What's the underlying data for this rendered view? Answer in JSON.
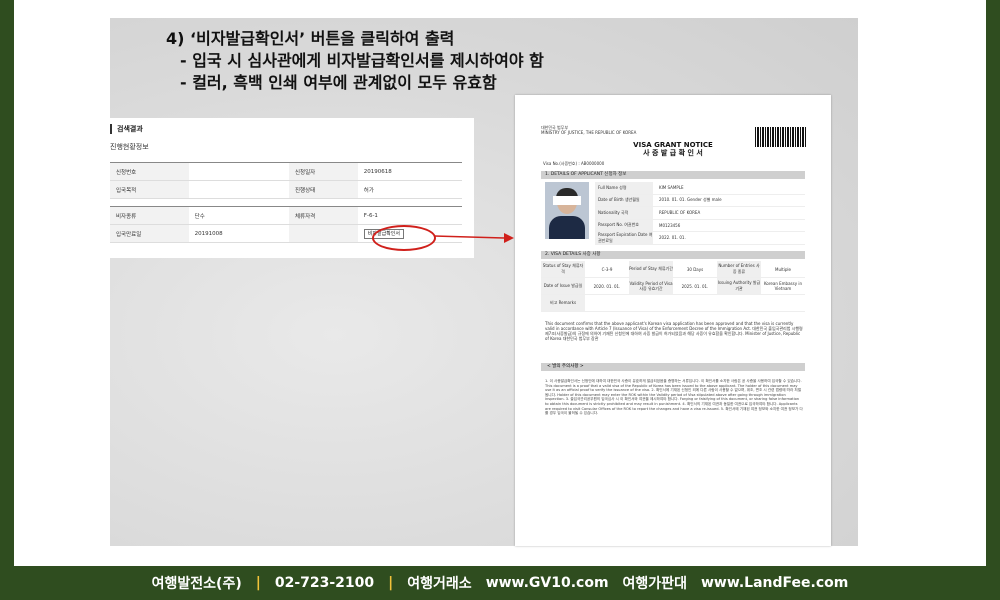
{
  "heading": {
    "line1": "4) ‘비자발급확인서’ 버튼을 클릭하여 출력",
    "line2": "- 입국 시 심사관에게 비자발급확인서를 제시하여야 함",
    "line3": "- 컬러, 흑백 인쇄 여부에 관계없이 모두 유효함"
  },
  "panel": {
    "title": "검색결과",
    "subtitle": "진행현황정보",
    "rows": [
      {
        "k1": "신청번호",
        "v1": "",
        "k2": "신청일자",
        "v2": "20190618"
      },
      {
        "k1": "입국목적",
        "v1": "",
        "k2": "진행상태",
        "v2": "허가"
      },
      {
        "k1": "비자종류",
        "v1": "단수",
        "k2": "체류자격",
        "v2": "F-6-1"
      },
      {
        "k1": "입국만료일",
        "v1": "20191008",
        "k2": "",
        "v2": ""
      }
    ],
    "issue_button": "비자발급확인서"
  },
  "doc": {
    "ministry": "대한민국 법무부\nMINISTRY OF JUSTICE, THE REPUBLIC OF KOREA",
    "title_en": "VISA GRANT NOTICE",
    "title_ko": "사 증 발 급 확 인 서",
    "visa_no": "Visa No.(사증번호) : AB0000000",
    "sec1": "1. DETAILS OF APPLICANT 신청자 정보",
    "personal": [
      {
        "a": "Full Name 성명",
        "b": "KIM SAMPLE"
      },
      {
        "a": "Date of Birth 생년월일",
        "b": "2010. 01. 01.    Gender 성별    male"
      },
      {
        "a": "Nationality 국적",
        "b": "REPUBLIC OF KOREA"
      },
      {
        "a": "Passport No. 여권번호",
        "b": "M0123456"
      },
      {
        "a": "Passport Expiration Date 여권만료일",
        "b": "2022. 01. 01."
      }
    ],
    "sec2": "2. VISA DETAILS 사증 사항",
    "visa_rows": [
      [
        "Status of Stay 체류자격",
        "C-3-9",
        "Period of Stay 체류기간",
        "30 Days",
        "Number of Entries 사증 종류",
        "Multiple"
      ],
      [
        "Date of Issue 발급일",
        "2020. 01. 01.",
        "Validity Period of Visa 사증 유효기간",
        "2025. 01. 01.",
        "Issuing Authority 발급 기관",
        "Korean Embassy in Vietnam"
      ],
      [
        "비고 Remarks",
        "",
        "",
        "",
        "",
        ""
      ]
    ],
    "paragraph": "This document confirms that the above applicant's Korean visa application has been approved and that the visa is currently valid in accordance with Article 7 (Issuance of Visa) of the Enforcement Decree of the Immigration Act. 대한민국 출입국관리법 시행령 제7조(사증발급)의 규정에 의하여 기재된 신청인에 대하여 사증 발급이 허가되었음과 해당 사증이 유효함을 확인합니다. Minister of Justice, Republic of Korea 대한민국 법무부 장관",
    "notes_title": "< 발의 주의사항 >",
    "notes": "1. 이 사증발급확인서는 신청인에 대하여 대한민국 사증이 유효하게 발급되었음을 증명하는 서류입니다. 이 확인서를 소지한 사람은 공 사증을 사용하여 입국할 수 있습니다. This document is a proof that a valid visa of the Republic of Korea has been issued to the above applicant. The holder of this document may use it as an official proof to verify the issuance of the visa. 2. 확인서에 기재된 신청인 외에 다른 사람이 사용할 수 없으며, 위조, 변조 시 관련 법령에 따라 처벌됩니다. Holder of this document may enter the ROK within the Validity period of Visa stipulated above after going through immigration inspection. 3. 출입국관리공무원의 입국심사 시 이 확인서와 여권을 제시하여야 합니다. Forging or falsifying of this document, or sharing false information to obtain this document is strictly prohibited and may result in punishment. 4. 확인서의 기재된 여권과 동일한 여권으로 입국하여야 합니다. Applicants are required to visit Consular Offices of the ROK to report the changes and have a visa re-issued. 5. 확인서에 기재된 여권 정보와 소지한 여권 정보가 다를 경우 입국이 불허될 수 있습니다."
  },
  "footer": {
    "company": "여행발전소(주)",
    "phone": "02-723-2100",
    "shop": "여행거래소",
    "site1": "www.GV10.com",
    "board": "여행가판대",
    "site2": "www.LandFee.com",
    "sep": "|"
  },
  "colors": {
    "footer_bg": "#2f4d1f",
    "accent_red": "#d0201b",
    "separator": "#f2c23a"
  }
}
